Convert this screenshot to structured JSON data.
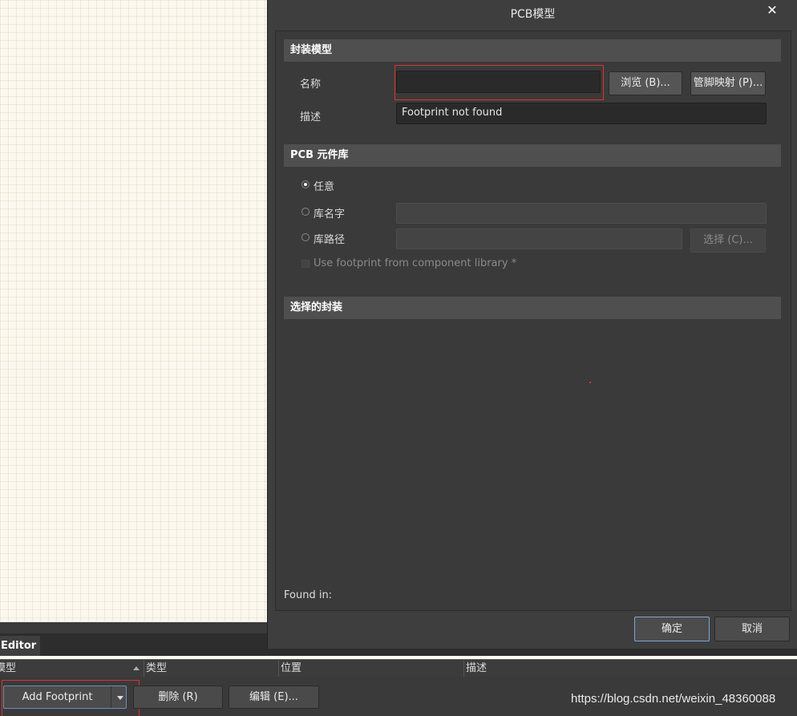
{
  "dialog": {
    "title": "PCB模型",
    "close_glyph": "✕",
    "sections": {
      "footprint_model": "封装模型",
      "pcb_library": "PCB 元件库",
      "selected_footprint": "选择的封装"
    },
    "name_label": "名称",
    "name_value": "",
    "browse_button": "浏览 (B)...",
    "pin_map_button": "管脚映射 (P)...",
    "description_label": "描述",
    "description_value": "Footprint not found",
    "radio_any": "任意",
    "radio_lib_name": "库名字",
    "radio_lib_path": "库路径",
    "lib_name_value": "",
    "lib_path_value": "",
    "choose_button": "选择 (C)...",
    "use_footprint_checkbox": "Use footprint from component library *",
    "found_in_label": "Found in:",
    "ok_button": "确定",
    "cancel_button": "取消"
  },
  "editor": {
    "tab_label": "Editor",
    "columns": [
      "模型",
      "类型",
      "位置",
      "描述"
    ],
    "add_footprint_button": "Add Footprint",
    "delete_button": "删除 (R)",
    "edit_button": "编辑 (E)..."
  },
  "watermark": "https://blog.csdn.net/weixin_48360088",
  "colors": {
    "dialog_bg": "#3e3e3e",
    "section_header": "#4f4f4f",
    "highlight_border": "#e03030",
    "focus_border": "#7ea6d1"
  }
}
